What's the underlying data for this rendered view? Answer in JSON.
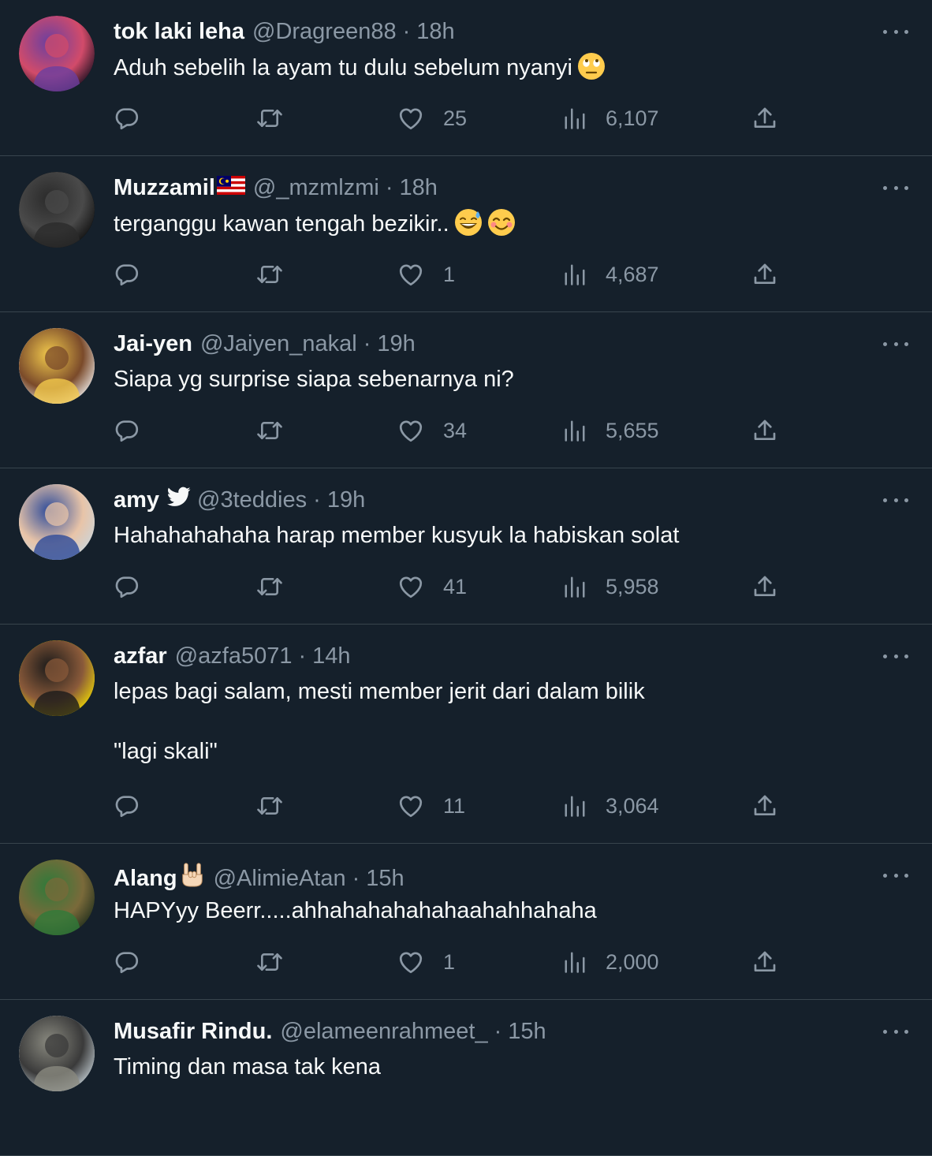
{
  "tweets": [
    {
      "name": "tok laki leha",
      "handle": "@Dragreen88",
      "separator": "·",
      "time": "18h",
      "text": "Aduh sebelih la ayam tu dulu sebelum nyanyi",
      "emoji": [
        "face-with-rolling-eyes"
      ],
      "likes": "25",
      "views": "6,107",
      "avatar_colors": [
        "#0b0b1a",
        "#6a3fa0",
        "#d24b6a"
      ]
    },
    {
      "name": "Muzzamil",
      "name_flag": "malaysia-flag",
      "handle": "@_mzmlzmi",
      "separator": "·",
      "time": "18h",
      "text": "terganggu kawan tengah bezikir..",
      "emoji": [
        "grinning-face-with-sweat",
        "smiling-face-with-smiling-eyes"
      ],
      "likes": "1",
      "views": "4,687",
      "avatar_colors": [
        "#0a0a0a",
        "#2a2a2a",
        "#4a4a4a"
      ]
    },
    {
      "name": "Jai-yen",
      "handle": "@Jaiyen_nakal",
      "separator": "·",
      "time": "19h",
      "text": "Siapa yg surprise siapa sebenarnya ni?",
      "emoji": [],
      "likes": "34",
      "views": "5,655",
      "avatar_colors": [
        "#f4f4f4",
        "#f2c94c",
        "#7a4a2a"
      ]
    },
    {
      "name": "amy",
      "name_badge": "bird-icon",
      "handle": "@3teddies",
      "separator": "·",
      "time": "19h",
      "text": "Hahahahahaha harap member kusyuk la habiskan solat",
      "emoji": [],
      "likes": "41",
      "views": "5,958",
      "avatar_colors": [
        "#c9d6de",
        "#2c4a9a",
        "#e8c4a8"
      ]
    },
    {
      "name": "azfar",
      "handle": "@azfa5071",
      "separator": "·",
      "time": "14h",
      "text": "lepas bagi salam, mesti member jerit dari dalam bilik\n\n\"lagi skali\"",
      "emoji": [],
      "likes": "11",
      "views": "3,064",
      "avatar_colors": [
        "#f5e000",
        "#1a1a1a",
        "#8a5a3a"
      ]
    },
    {
      "name": "Alang",
      "name_emoji": "sign-of-the-horns",
      "handle": "@AlimieAtan",
      "separator": "·",
      "time": "15h",
      "text": "HAPYyy Beerr.....ahhahahahahahaahahhahaha",
      "emoji": [],
      "likes": "1",
      "views": "2,000",
      "avatar_colors": [
        "#1a2a1a",
        "#2f7a3a",
        "#7a6a3a"
      ]
    },
    {
      "name": "Musafir Rindu.",
      "handle": "@elameenrahmeet_",
      "separator": "·",
      "time": "15h",
      "text": "Timing dan masa tak kena",
      "emoji": [],
      "likes": "",
      "views": "",
      "avatar_colors": [
        "#c9d4da",
        "#8a8a80",
        "#3a3a3a"
      ]
    }
  ]
}
